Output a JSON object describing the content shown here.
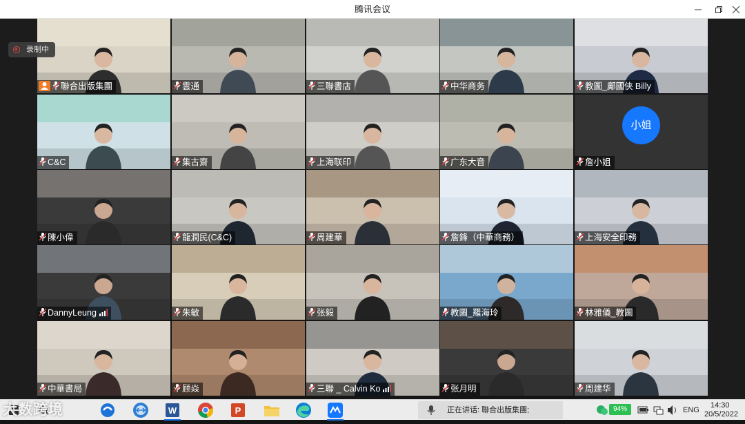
{
  "window": {
    "title": "腾讯会议"
  },
  "recording": {
    "label": "录制中"
  },
  "participants": [
    {
      "name": "聯合出版集團",
      "host": true,
      "signal": false
    },
    {
      "name": "雲通",
      "host": false,
      "signal": false
    },
    {
      "name": "三聯書店",
      "host": false,
      "signal": false
    },
    {
      "name": "中华商务",
      "host": false,
      "signal": false
    },
    {
      "name": "教圖_鄺國俠 Billy",
      "host": false,
      "signal": false
    },
    {
      "name": "C&C",
      "host": false,
      "signal": false
    },
    {
      "name": "集古齋",
      "host": false,
      "signal": false
    },
    {
      "name": "上海联印",
      "host": false,
      "signal": false
    },
    {
      "name": "广东大音",
      "host": false,
      "signal": false
    },
    {
      "name": "詹小姐",
      "host": false,
      "signal": false,
      "avatar_text": "小姐",
      "avatar_color": "#1677ff"
    },
    {
      "name": "陳小偉",
      "host": false,
      "signal": false
    },
    {
      "name": "龍潤民(C&C)",
      "host": false,
      "signal": false
    },
    {
      "name": "周建華",
      "host": false,
      "signal": false
    },
    {
      "name": "詹鋒（中華商務）",
      "host": false,
      "signal": false
    },
    {
      "name": "上海安全印務",
      "host": false,
      "signal": false
    },
    {
      "name": "DannyLeung",
      "host": false,
      "signal": true
    },
    {
      "name": "朱敏",
      "host": false,
      "signal": false
    },
    {
      "name": "张毅",
      "host": false,
      "signal": false
    },
    {
      "name": "教圖_羅海玲",
      "host": false,
      "signal": false
    },
    {
      "name": "林雅儀_教圖",
      "host": false,
      "signal": false
    },
    {
      "name": "中華書局",
      "host": false,
      "signal": false
    },
    {
      "name": "顾焱",
      "host": false,
      "signal": false
    },
    {
      "name": "三聯 _ Calvin Ko",
      "host": false,
      "signal": true
    },
    {
      "name": "张月明",
      "host": false,
      "signal": false
    },
    {
      "name": "周建华",
      "host": false,
      "signal": false
    }
  ],
  "taskbar": {
    "watermark": "大数跨境",
    "apps": [
      "windows-logo",
      "search-icon",
      "edge-legacy",
      "teamviewer",
      "word",
      "chrome",
      "powerpoint",
      "file-explorer",
      "edge",
      "tencent-meeting"
    ],
    "speaking_label": "正在讲话: 聯合出版集團;",
    "battery_percent": "94%",
    "language": "ENG",
    "time": "14:30",
    "date": "20/5/2022"
  },
  "colors": {
    "accent": "#1677ff",
    "host_badge": "#f27b25",
    "rec_dot": "#e64545",
    "battery": "#2cbf52"
  }
}
